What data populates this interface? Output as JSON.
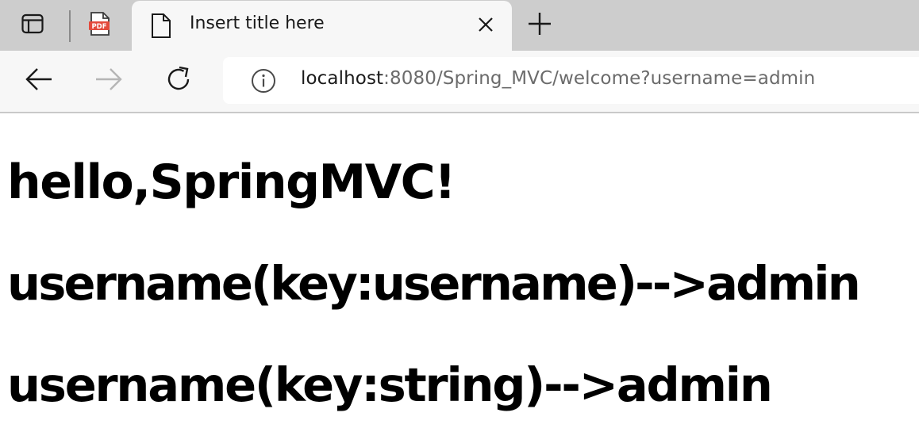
{
  "tabs": {
    "pdf_tab": {
      "icon": "pdf-file-icon",
      "label": "PDF"
    },
    "active": {
      "title": "Insert title here",
      "icon": "document-icon"
    }
  },
  "toolbar": {
    "url_host": "localhost",
    "url_rest": ":8080/Spring_MVC/welcome?username=admin"
  },
  "page": {
    "heading_1": "hello,SpringMVC!",
    "heading_2": "username(key:username)-->admin",
    "heading_3": "username(key:string)-->admin"
  },
  "colors": {
    "tabstrip_bg": "#cdcdcd",
    "toolbar_bg": "#f7f7f7",
    "pdf_red": "#e34a3c"
  }
}
